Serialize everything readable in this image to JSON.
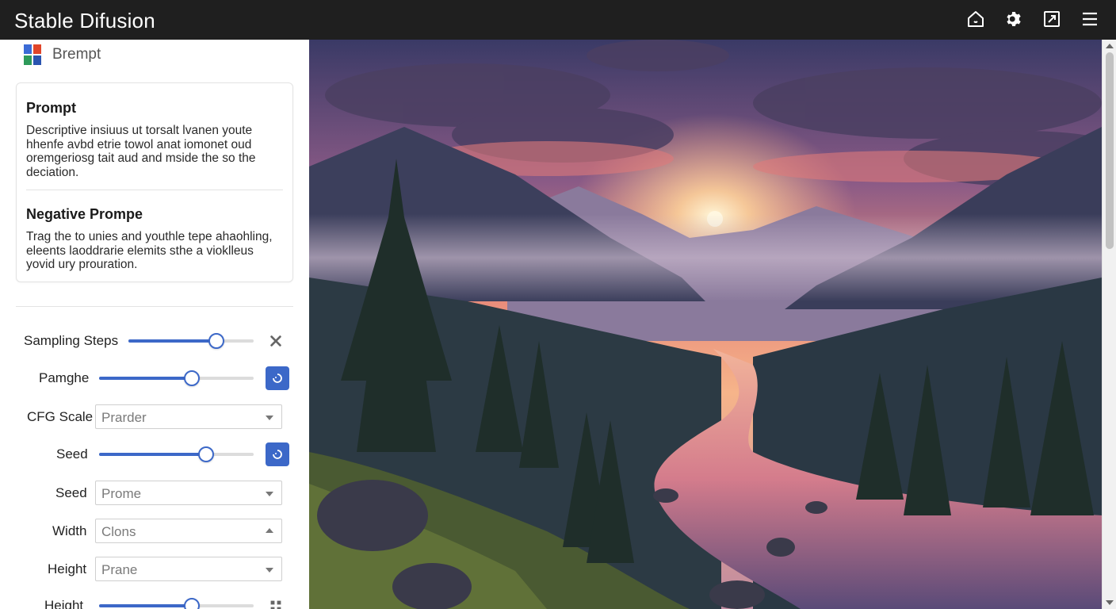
{
  "app": {
    "title": "Stable Difusion"
  },
  "header_icons": [
    "home-icon",
    "gear-icon",
    "share-icon",
    "menu-icon"
  ],
  "sidebar": {
    "brand_label": "Brempt",
    "prompt": {
      "heading": "Prompt",
      "text": "Descriptive insiuus ut torsalt lvanen youte hhenfe avbd etrie towol anat iomonet oud oremgeriosg tait aud and mside the so the deciation."
    },
    "negative_prompt": {
      "heading": "Negative Prompe",
      "text": "Trag the to unies and youthle tepe ahaohling, eleents laoddrarie elemits sthe a vioklleus yovid ury prouration."
    },
    "controls": [
      {
        "label": "Sampling Steps",
        "type": "slider",
        "value": 0.7,
        "action_icon": "close-x-icon"
      },
      {
        "label": "Pamghe",
        "type": "slider",
        "value": 0.6,
        "action_icon": "refresh-icon"
      },
      {
        "label": "CFG Scale",
        "type": "select",
        "value": "Prarder",
        "caret": "down"
      },
      {
        "label": "Seed",
        "type": "slider",
        "value": 0.69,
        "action_icon": "refresh-icon"
      },
      {
        "label": "Seed",
        "type": "select",
        "value": "Prome",
        "caret": "down"
      },
      {
        "label": "Width",
        "type": "select",
        "value": "Clons",
        "caret": "up"
      },
      {
        "label": "Height",
        "type": "select",
        "value": "Prane",
        "caret": "down"
      },
      {
        "label": "Height",
        "type": "slider",
        "value": 0.6,
        "action_icon": "grid-icon"
      }
    ]
  },
  "colors": {
    "accent": "#3c68c8",
    "topbar": "#1f1f1f"
  }
}
